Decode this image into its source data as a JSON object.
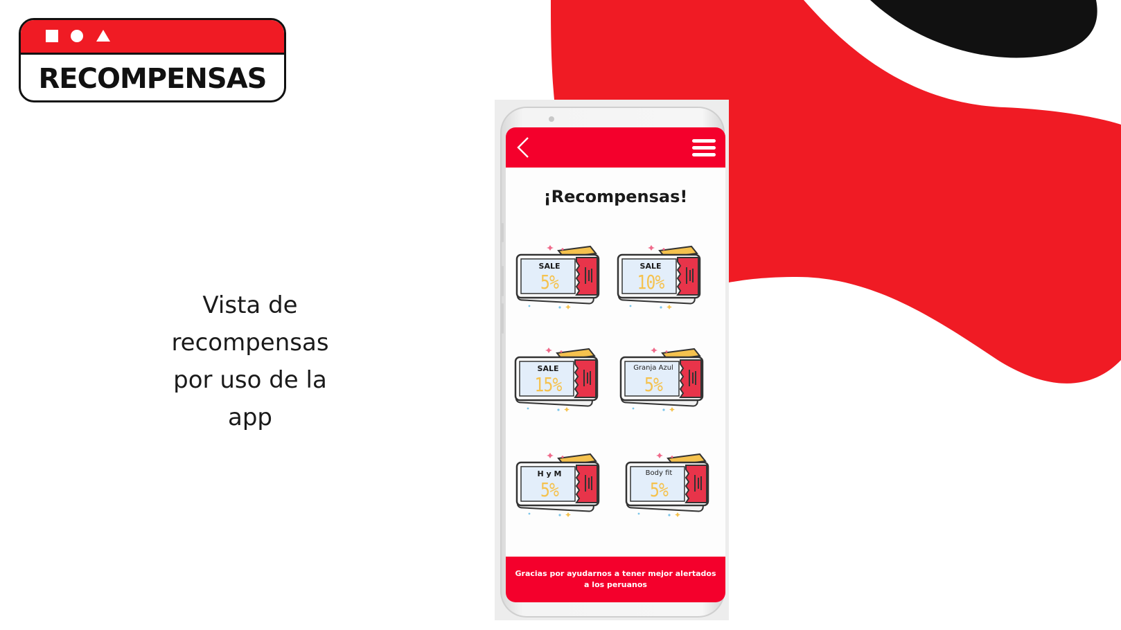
{
  "colors": {
    "accent_red": "#f01b24",
    "app_red": "#f4002c",
    "black": "#111111",
    "coupon_gold": "#f5c24e",
    "coupon_blue": "#e3eefa"
  },
  "title_card": {
    "title": "RECOMPENSAS",
    "icons": [
      "square-icon",
      "circle-icon",
      "triangle-icon"
    ]
  },
  "description": {
    "line1": "Vista de",
    "line2": "recompensas",
    "line3": "por uso de la",
    "line4": "app"
  },
  "phone": {
    "header": {
      "back_icon": "chevron-left-icon",
      "menu_icon": "hamburger-menu-icon"
    },
    "title": "¡Recompensas!",
    "coupons": [
      {
        "label": "SALE",
        "value": "5%"
      },
      {
        "label": "SALE",
        "value": "10%"
      },
      {
        "label": "SALE",
        "value": "15%"
      },
      {
        "label": "Granja Azul",
        "value": "5%"
      },
      {
        "label": "H y M",
        "value": "5%"
      },
      {
        "label": "Body fit",
        "value": "5%"
      }
    ],
    "footer": "Gracias por ayudarnos a tener mejor alertados a los peruanos"
  }
}
